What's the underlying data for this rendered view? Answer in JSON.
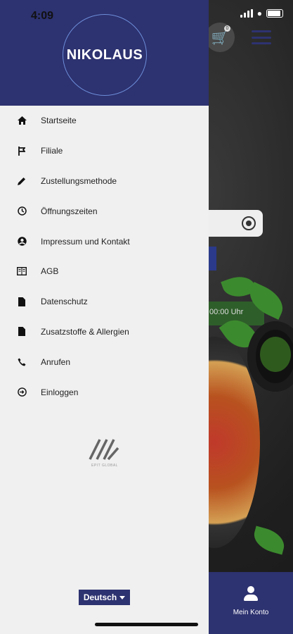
{
  "status_bar": {
    "time": "4:09"
  },
  "brand": {
    "name": "NIKOLAUS"
  },
  "menu": {
    "items": [
      {
        "label": "Startseite",
        "icon": "home-icon"
      },
      {
        "label": "Filiale",
        "icon": "branch-icon"
      },
      {
        "label": "Zustellungsmethode",
        "icon": "pencil-icon"
      },
      {
        "label": "Öffnungszeiten",
        "icon": "clock-icon"
      },
      {
        "label": "Impressum und Kontakt",
        "icon": "account-circle-icon"
      },
      {
        "label": "AGB",
        "icon": "book-icon"
      },
      {
        "label": "Datenschutz",
        "icon": "document-icon"
      },
      {
        "label": "Zusatzstoffe & Allergien",
        "icon": "document-icon"
      },
      {
        "label": "Anrufen",
        "icon": "phone-icon"
      },
      {
        "label": "Einloggen",
        "icon": "login-icon"
      }
    ]
  },
  "company": {
    "name": "EPIT GLOBAL"
  },
  "language": {
    "selected": "Deutsch"
  },
  "background": {
    "hours_text": "00:00 Uhr",
    "account_label": "Mein Konto",
    "cart_count": "0"
  },
  "colors": {
    "brand": "#2d3270",
    "drawer_bg": "#f0f0f0",
    "accent_ring": "#6c8dd8"
  }
}
